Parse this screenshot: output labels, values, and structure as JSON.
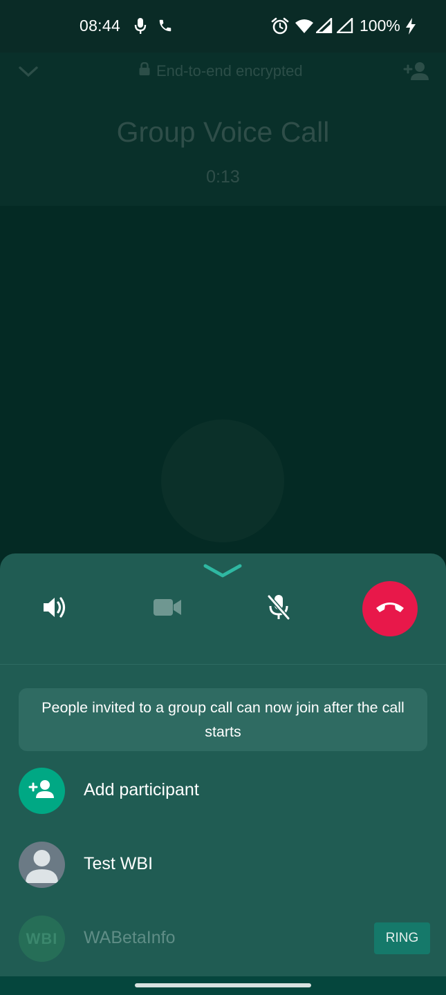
{
  "status_bar": {
    "time": "08:44",
    "battery": "100%",
    "icons": [
      "microphone-icon",
      "phone-icon",
      "alarm-icon",
      "wifi-icon",
      "signal-icon",
      "signal-icon",
      "charging-icon"
    ]
  },
  "header": {
    "encryption_text": "End-to-end encrypted",
    "title": "Group Voice Call",
    "timer": "0:13",
    "icons": [
      "chevron-down-icon",
      "lock-icon",
      "add-person-icon"
    ]
  },
  "controls": {
    "icons": [
      "speaker-icon",
      "video-camera-icon",
      "mute-microphone-icon",
      "end-call-icon"
    ]
  },
  "banner": {
    "text": "People invited to a group call can now join after the call starts"
  },
  "participants": [
    {
      "name": "Add participant",
      "icon": "add-person-icon"
    },
    {
      "name": "Test WBI",
      "icon": "default-avatar-icon"
    },
    {
      "name": "WABetaInfo",
      "avatar_text": "WBI",
      "action": "RING"
    }
  ],
  "colors": {
    "background": "#042a24",
    "sheet": "#205c53",
    "end_call": "#e8184a",
    "accent": "#00a884"
  }
}
